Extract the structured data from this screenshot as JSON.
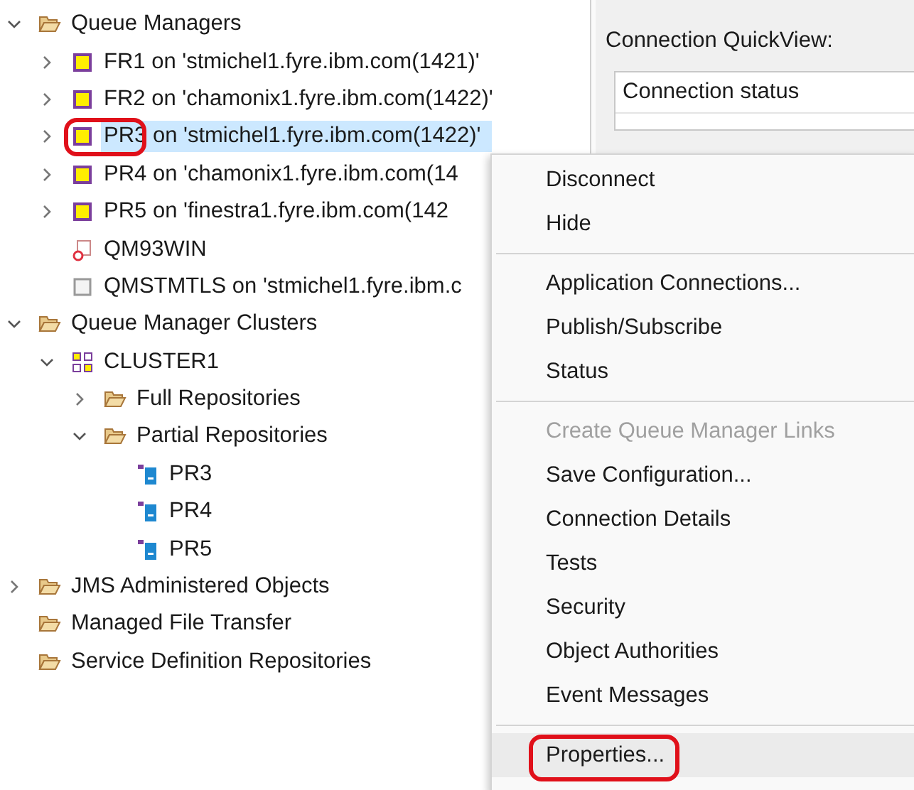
{
  "tree": [
    {
      "label": "Queue Managers",
      "kind": "folder",
      "expanded": true,
      "selected": false,
      "annotated": false,
      "children": [
        {
          "label": "FR1 on 'stmichel1.fyre.ibm.com(1421)'",
          "kind": "qmgr",
          "expanded": false,
          "selected": false,
          "annotated": false
        },
        {
          "label": "FR2 on 'chamonix1.fyre.ibm.com(1422)'",
          "kind": "qmgr",
          "expanded": false,
          "selected": false,
          "annotated": false
        },
        {
          "label": "PR3 on 'stmichel1.fyre.ibm.com(1422)'",
          "kind": "qmgr",
          "expanded": false,
          "selected": true,
          "annotated": true
        },
        {
          "label": "PR4 on 'chamonix1.fyre.ibm.com(14",
          "kind": "qmgr",
          "expanded": false,
          "selected": false,
          "annotated": false
        },
        {
          "label": "PR5 on 'finestra1.fyre.ibm.com(142",
          "kind": "qmgr",
          "expanded": false,
          "selected": false,
          "annotated": false
        },
        {
          "label": "QM93WIN",
          "kind": "qmgr-error",
          "selected": false,
          "annotated": false
        },
        {
          "label": "QMSTMTLS on 'stmichel1.fyre.ibm.c",
          "kind": "qmgr-stopped",
          "selected": false,
          "annotated": false
        }
      ]
    },
    {
      "label": "Queue Manager Clusters",
      "kind": "folder",
      "expanded": true,
      "selected": false,
      "annotated": false,
      "children": [
        {
          "label": "CLUSTER1",
          "kind": "cluster",
          "expanded": true,
          "selected": false,
          "annotated": false,
          "children": [
            {
              "label": "Full Repositories",
              "kind": "folder",
              "expanded": false,
              "selected": false,
              "annotated": false
            },
            {
              "label": "Partial Repositories",
              "kind": "folder",
              "expanded": true,
              "selected": false,
              "annotated": false,
              "children": [
                {
                  "label": "PR3",
                  "kind": "member",
                  "selected": false,
                  "annotated": false
                },
                {
                  "label": "PR4",
                  "kind": "member",
                  "selected": false,
                  "annotated": false
                },
                {
                  "label": "PR5",
                  "kind": "member",
                  "selected": false,
                  "annotated": false
                }
              ]
            }
          ]
        }
      ]
    },
    {
      "label": "JMS Administered Objects",
      "kind": "folder",
      "expanded": false,
      "selected": false,
      "annotated": false
    },
    {
      "label": "Managed File Transfer",
      "kind": "folder",
      "selected": false,
      "annotated": false
    },
    {
      "label": "Service Definition Repositories",
      "kind": "folder",
      "selected": false,
      "annotated": false
    }
  ],
  "quickview": {
    "title": "Connection QuickView:",
    "rows": [
      "Connection status"
    ]
  },
  "context_menu": [
    {
      "kind": "item",
      "label": "Disconnect",
      "disabled": false,
      "highlighted": false,
      "annotated": false
    },
    {
      "kind": "item",
      "label": "Hide",
      "disabled": false,
      "highlighted": false,
      "annotated": false
    },
    {
      "kind": "separator"
    },
    {
      "kind": "item",
      "label": "Application Connections...",
      "disabled": false,
      "highlighted": false,
      "annotated": false
    },
    {
      "kind": "item",
      "label": "Publish/Subscribe",
      "disabled": false,
      "highlighted": false,
      "annotated": false
    },
    {
      "kind": "item",
      "label": "Status",
      "disabled": false,
      "highlighted": false,
      "annotated": false
    },
    {
      "kind": "separator"
    },
    {
      "kind": "item",
      "label": "Create Queue Manager Links",
      "disabled": true,
      "highlighted": false,
      "annotated": false
    },
    {
      "kind": "item",
      "label": "Save Configuration...",
      "disabled": false,
      "highlighted": false,
      "annotated": false
    },
    {
      "kind": "item",
      "label": "Connection Details",
      "disabled": false,
      "highlighted": false,
      "annotated": false
    },
    {
      "kind": "item",
      "label": "Tests",
      "disabled": false,
      "highlighted": false,
      "annotated": false
    },
    {
      "kind": "item",
      "label": "Security",
      "disabled": false,
      "highlighted": false,
      "annotated": false
    },
    {
      "kind": "item",
      "label": "Object Authorities",
      "disabled": false,
      "highlighted": false,
      "annotated": false
    },
    {
      "kind": "item",
      "label": "Event Messages",
      "disabled": false,
      "highlighted": false,
      "annotated": false
    },
    {
      "kind": "separator"
    },
    {
      "kind": "item",
      "label": "Properties...",
      "disabled": false,
      "highlighted": true,
      "annotated": true
    }
  ]
}
